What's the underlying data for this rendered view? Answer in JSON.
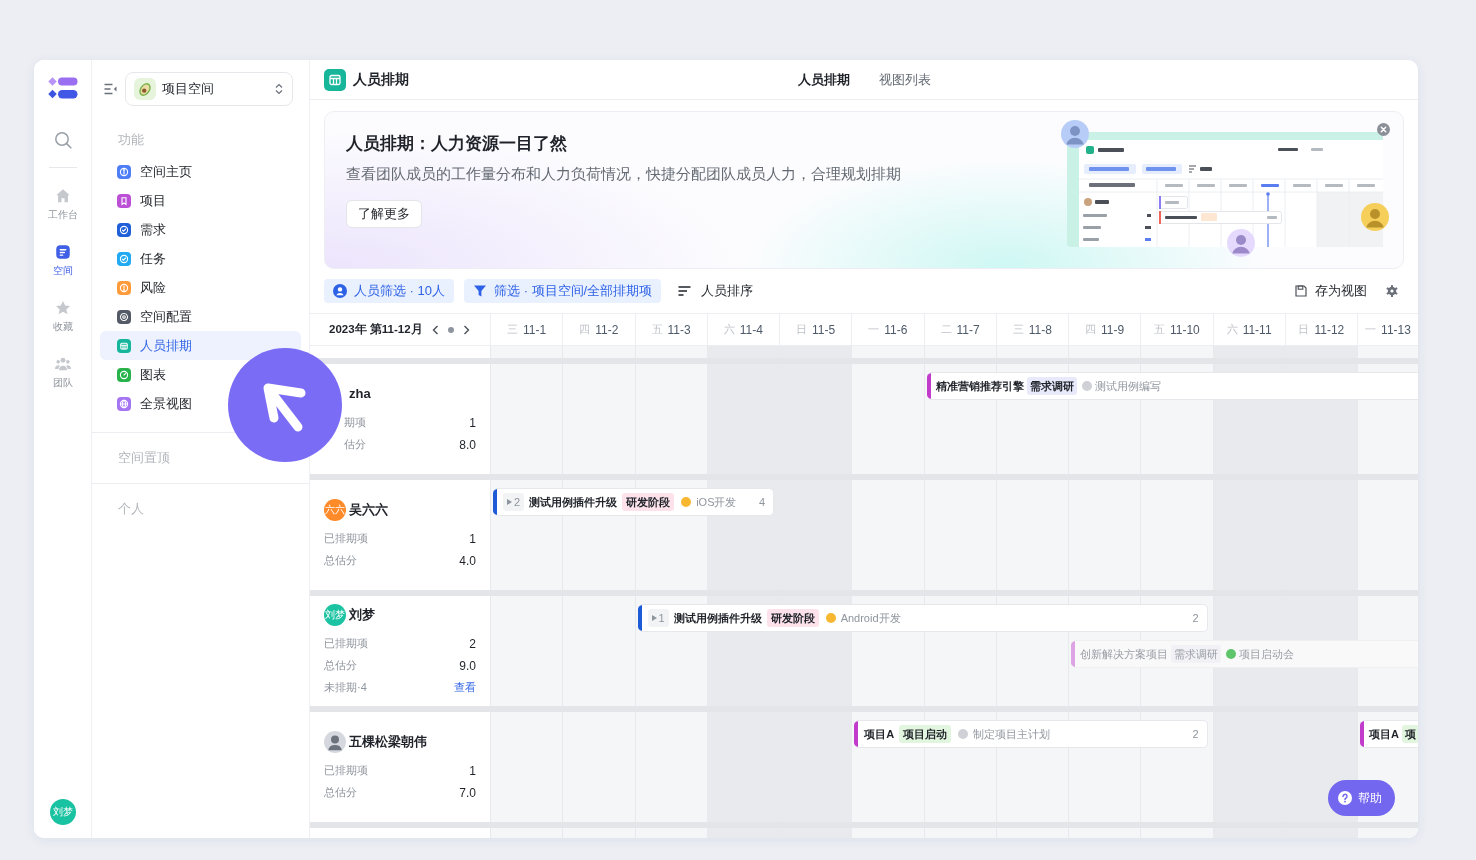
{
  "rail": {
    "items": [
      {
        "label": "工作台",
        "selected": false
      },
      {
        "label": "空间",
        "selected": true
      },
      {
        "label": "收藏",
        "selected": false
      },
      {
        "label": "团队",
        "selected": false
      }
    ],
    "user_avatar": "刘梦"
  },
  "sidebar": {
    "workspace": "项目空间",
    "section_title": "功能",
    "items": [
      {
        "label": "空间主页",
        "selected": false
      },
      {
        "label": "项目",
        "selected": false
      },
      {
        "label": "需求",
        "selected": false
      },
      {
        "label": "任务",
        "selected": false
      },
      {
        "label": "风险",
        "selected": false
      },
      {
        "label": "空间配置",
        "selected": false
      },
      {
        "label": "人员排期",
        "selected": true
      },
      {
        "label": "图表",
        "selected": false
      },
      {
        "label": "全景视图",
        "selected": false
      }
    ],
    "groups": [
      "空间置顶",
      "个人"
    ]
  },
  "header": {
    "title": "人员排期",
    "tabs": [
      {
        "label": "人员排期",
        "selected": true
      },
      {
        "label": "视图列表",
        "selected": false
      }
    ]
  },
  "banner": {
    "title": "人员排期：人力资源一目了然",
    "description": "查看团队成员的工作量分布和人力负荷情况，快捷分配团队成员人力，合理规划排期",
    "button": "了解更多"
  },
  "toolbar": {
    "filters": [
      "人员筛选 · 10人",
      "筛选 · 项目空间/全部排期项"
    ],
    "sort": "人员排序",
    "save_view": "存为视图"
  },
  "timeline": {
    "period": "2023年 第11-12月",
    "days": [
      {
        "weekday": "三",
        "date": "11-1",
        "weekend": false
      },
      {
        "weekday": "四",
        "date": "11-2",
        "weekend": false
      },
      {
        "weekday": "五",
        "date": "11-3",
        "weekend": false
      },
      {
        "weekday": "六",
        "date": "11-4",
        "weekend": true
      },
      {
        "weekday": "日",
        "date": "11-5",
        "weekend": true
      },
      {
        "weekday": "一",
        "date": "11-6",
        "weekend": false
      },
      {
        "weekday": "二",
        "date": "11-7",
        "weekend": false
      },
      {
        "weekday": "三",
        "date": "11-8",
        "weekend": false
      },
      {
        "weekday": "四",
        "date": "11-9",
        "weekend": false
      },
      {
        "weekday": "五",
        "date": "11-10",
        "weekend": false
      },
      {
        "weekday": "六",
        "date": "11-11",
        "weekend": true
      },
      {
        "weekday": "日",
        "date": "11-12",
        "weekend": true
      },
      {
        "weekday": "一",
        "date": "11-13",
        "weekend": false
      }
    ],
    "members": [
      {
        "name": "zha",
        "pointer_over": true,
        "stats": [
          {
            "kind": "text",
            "label": "期项",
            "value": "1"
          },
          {
            "kind": "text",
            "label": "估分",
            "value": "8.0"
          }
        ],
        "lanes": [
          [
            {
              "title": "精准营销推荐引擎",
              "color": "#c23ccc",
              "tag": {
                "text": "需求调研",
                "color": "#e8eafb"
              },
              "status": {
                "text": "测试用例编写",
                "color": "#cfd1d6"
              },
              "faded": false
            }
          ]
        ]
      },
      {
        "name": "吴六六",
        "avatar": {
          "kind": "initials",
          "text": "六六",
          "color": "#ff8a2a"
        },
        "pointer_over": false,
        "stats": [
          {
            "kind": "text",
            "label": "已排期项",
            "value": "1"
          },
          {
            "kind": "text",
            "label": "总估分",
            "value": "4.0"
          }
        ],
        "lanes": [
          [
            {
              "subtasks": "2",
              "title": "测试用例插件升级",
              "color": "#1d5ad6",
              "tag": {
                "text": "研发阶段",
                "color": "#fde2ec"
              },
              "status": {
                "text": "iOS开发",
                "color": "#f7b731"
              },
              "count": "4",
              "faded": false
            }
          ]
        ]
      },
      {
        "name": "刘梦",
        "avatar": {
          "kind": "initials",
          "text": "刘梦",
          "color": "#1cc3a2"
        },
        "pointer_over": false,
        "stats": [
          {
            "kind": "text",
            "label": "已排期项",
            "value": "2"
          },
          {
            "kind": "text",
            "label": "总估分",
            "value": "9.0"
          },
          {
            "kind": "link",
            "label": "未排期·4",
            "value": "查看"
          }
        ],
        "lanes": [
          [
            {
              "subtasks": "1",
              "title": "测试用例插件升级",
              "color": "#1d5ad6",
              "tag": {
                "text": "研发阶段",
                "color": "#fde2ec"
              },
              "status": {
                "text": "Android开发",
                "color": "#f7b731"
              },
              "count": "2",
              "faded": false
            }
          ],
          [
            {
              "title": "创新解决方案项目",
              "color": "#dda3e4",
              "tag": {
                "text": "需求调研",
                "color": "#f1f1f6"
              },
              "status": {
                "text": "项目启动会",
                "color": "#5ec56b"
              },
              "faded": true
            }
          ]
        ]
      },
      {
        "name": "五棵松梁朝伟",
        "avatar": {
          "kind": "photo"
        },
        "pointer_over": false,
        "stats": [
          {
            "kind": "text",
            "label": "已排期项",
            "value": "1"
          },
          {
            "kind": "text",
            "label": "总估分",
            "value": "7.0"
          }
        ],
        "lanes": [
          [
            {
              "title": "项目A",
              "color": "#c23ccc",
              "tag": {
                "text": "项目启动",
                "color": "#e2f5df"
              },
              "status": {
                "text": "制定项目主计划",
                "color": "#cfd1d6"
              },
              "count": "2",
              "faded": false
            },
            {
              "title": "项目A",
              "color": "#c23ccc",
              "tag": {
                "text": "项",
                "color": "#e2f5df"
              },
              "faded": false
            }
          ]
        ]
      }
    ]
  },
  "help": "帮助"
}
